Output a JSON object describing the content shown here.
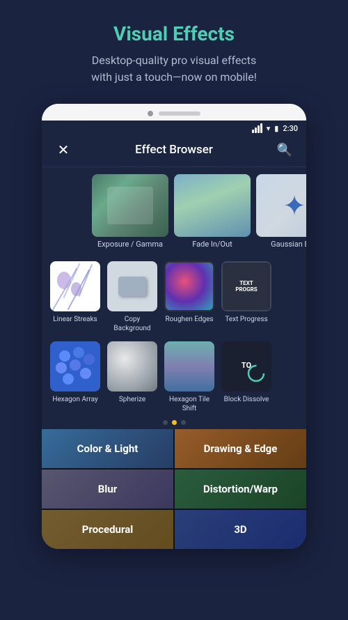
{
  "header": {
    "title": "Visual Effects",
    "subtitle": "Desktop-quality pro visual effects\nwith just a touch—now on mobile!"
  },
  "statusBar": {
    "time": "2:30"
  },
  "appBar": {
    "title": "Effect Browser",
    "closeIcon": "✕",
    "searchIcon": "🔍"
  },
  "bigEffects": [
    {
      "label": "Exposure / Gamma"
    },
    {
      "label": "Fade In/Out"
    },
    {
      "label": "Gaussian Blur"
    }
  ],
  "smallEffectsRow1": [
    {
      "label": "Linear Streaks"
    },
    {
      "label": "Copy Background"
    },
    {
      "label": "Roughen Edges"
    },
    {
      "label": "Text Progress"
    }
  ],
  "smallEffectsRow2": [
    {
      "label": "Hexagon Array"
    },
    {
      "label": "Spherize"
    },
    {
      "label": "Hexagon Tile Shift"
    },
    {
      "label": "Block Dissolve"
    }
  ],
  "dots": [
    {
      "active": false
    },
    {
      "active": true
    },
    {
      "active": false
    }
  ],
  "categories": [
    {
      "label": "Color & Light",
      "class": "cat-color-light"
    },
    {
      "label": "Drawing & Edge",
      "class": "cat-drawing-edge"
    },
    {
      "label": "Blur",
      "class": "cat-blur"
    },
    {
      "label": "Distortion/Warp",
      "class": "cat-distortion"
    },
    {
      "label": "Procedural",
      "class": "cat-procedural"
    },
    {
      "label": "3D",
      "class": "cat-3d"
    }
  ]
}
